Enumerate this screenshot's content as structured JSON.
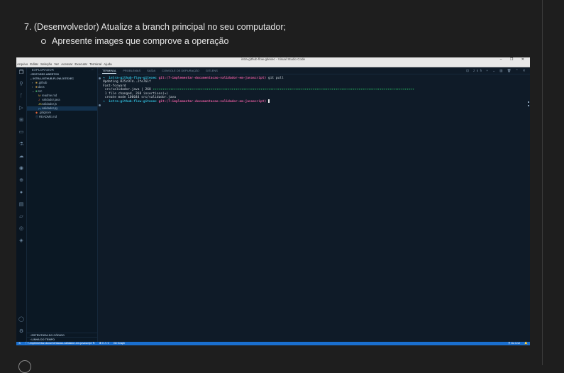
{
  "instructions": {
    "step": "7. (Desenvolvedor) Atualize a branch principal no seu computador;",
    "sub": "Apresente images que comprove a operação"
  },
  "vscode": {
    "window_title": "intra-github-flow-gitexec - Visual Studio Code",
    "window_controls": "– ❐ ✕",
    "menu": [
      "Arquivo",
      "Editar",
      "Seleção",
      "Ver",
      "Acessar",
      "Executar",
      "Terminal",
      "Ajuda"
    ],
    "sidebar": {
      "title": "EXPLORADOR",
      "more": "···",
      "open_editors": "EDITORES ABERTOS",
      "project": "INTRA-GITHUB-FLOW-GITEXEC",
      "tree": [
        {
          "label": ".github",
          "icon": "folder-icon"
        },
        {
          "label": "docs",
          "icon": "folder-icon"
        },
        {
          "label": "src",
          "icon": "folder-open-icon"
        },
        {
          "label": "readme.md",
          "icon": "markdown-file-icon"
        },
        {
          "label": "validador.java",
          "icon": "java-file-icon"
        },
        {
          "label": "validador.js",
          "icon": "js-file-icon"
        },
        {
          "label": "validador.py",
          "icon": "python-file-icon"
        },
        {
          "label": ".gitignore",
          "icon": "git-file-icon"
        },
        {
          "label": "README.md",
          "icon": "info-file-icon"
        }
      ],
      "outline": "ESTRUTURA DO CÓDIGO",
      "timeline": "LINHA DO TEMPO"
    },
    "panel_tabs": [
      "TERMINAL",
      "PROBLEMAS",
      "SAÍDA",
      "CONSOLE DE DEPURAÇÃO",
      "GITLENS"
    ],
    "panel_tools": "⊡ zsh + ⌄ ▥ 🗑 ⌃ ✕",
    "terminal": {
      "prompt1_dir": "→  intra-github-flow-gitexec",
      "prompt1_branch": "git:(7-implementar-documentacao-validador-em-javascript)",
      "cmd1": " git pull",
      "line_updating": "Updating 025c97d..2fe761f",
      "line_ff": "Fast-forward",
      "line_stat_file": " src/validador.java | 268 ",
      "line_stat_plus": "++++++++++++++++++++++++++++++++++++++++++++++++++++++++++++++++++++++++++++++++++++++++++++++++++++++++++++++++++++++++++++++++++++++++",
      "line_changed": " 1 file changed, 268 insertions(+)",
      "line_create": " create mode 100644 src/validador.java",
      "prompt2_dir": "→  intra-github-flow-gitexec",
      "prompt2_branch": "git:(7-implementar-documentacao-validador-em-javascript)"
    },
    "status": {
      "left": [
        "⨯",
        "ᚴ 7-implementar-documentacao-validador-em-javascript ↻",
        "⊗ 0 ⚠ 0",
        "Git Graph"
      ],
      "right": [
        "⚲ Go Live",
        "🔔"
      ]
    },
    "colors": {
      "statusbar": "#1a6fcf",
      "background": "#0f1b28",
      "branch": "#e05a9c",
      "prompt": "#2fb8d6"
    }
  }
}
